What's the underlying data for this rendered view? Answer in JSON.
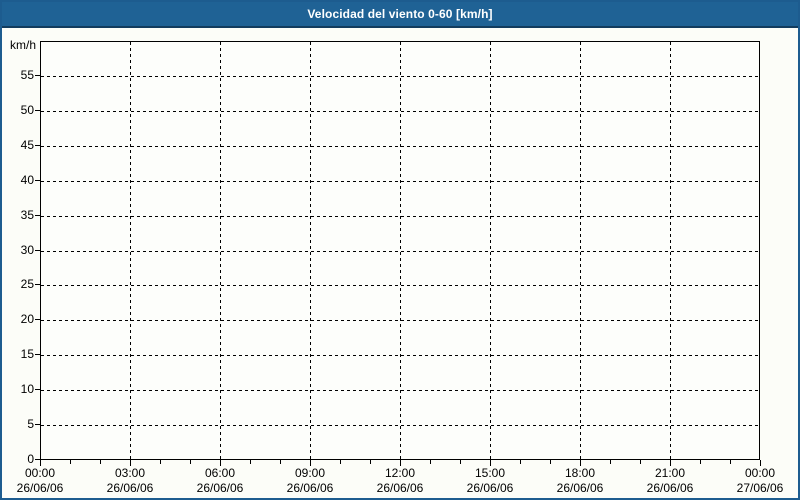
{
  "window": {
    "title": "Velocidad del viento 0-60 [km/h]"
  },
  "colors": {
    "titlebar_bg": "#1f6295",
    "titlebar_border": "#123c5e",
    "page_border": "#1d5c8f",
    "background": "#fcfdf8",
    "title_text": "#ffffff",
    "grid_and_axis": "#000000"
  },
  "chart_data": {
    "type": "line",
    "title": "Velocidad del viento 0-60 [km/h]",
    "xlabel": "",
    "ylabel": "km/h",
    "ylim": [
      0,
      60
    ],
    "y_tick_step": 5,
    "y_ticks": [
      0,
      5,
      10,
      15,
      20,
      25,
      30,
      35,
      40,
      45,
      50,
      55
    ],
    "total_hours": 24,
    "x_major_step_hours": 3,
    "x_minor_step_hours": 1,
    "grid": "dashed",
    "legend": "none",
    "x_ticks": [
      {
        "time": "00:00",
        "date": "26/06/06"
      },
      {
        "time": "03:00",
        "date": "26/06/06"
      },
      {
        "time": "06:00",
        "date": "26/06/06"
      },
      {
        "time": "09:00",
        "date": "26/06/06"
      },
      {
        "time": "12:00",
        "date": "26/06/06"
      },
      {
        "time": "15:00",
        "date": "26/06/06"
      },
      {
        "time": "18:00",
        "date": "26/06/06"
      },
      {
        "time": "21:00",
        "date": "26/06/06"
      },
      {
        "time": "00:00",
        "date": "27/06/06"
      }
    ],
    "series": [
      {
        "name": "Velocidad del viento",
        "values": []
      }
    ]
  }
}
